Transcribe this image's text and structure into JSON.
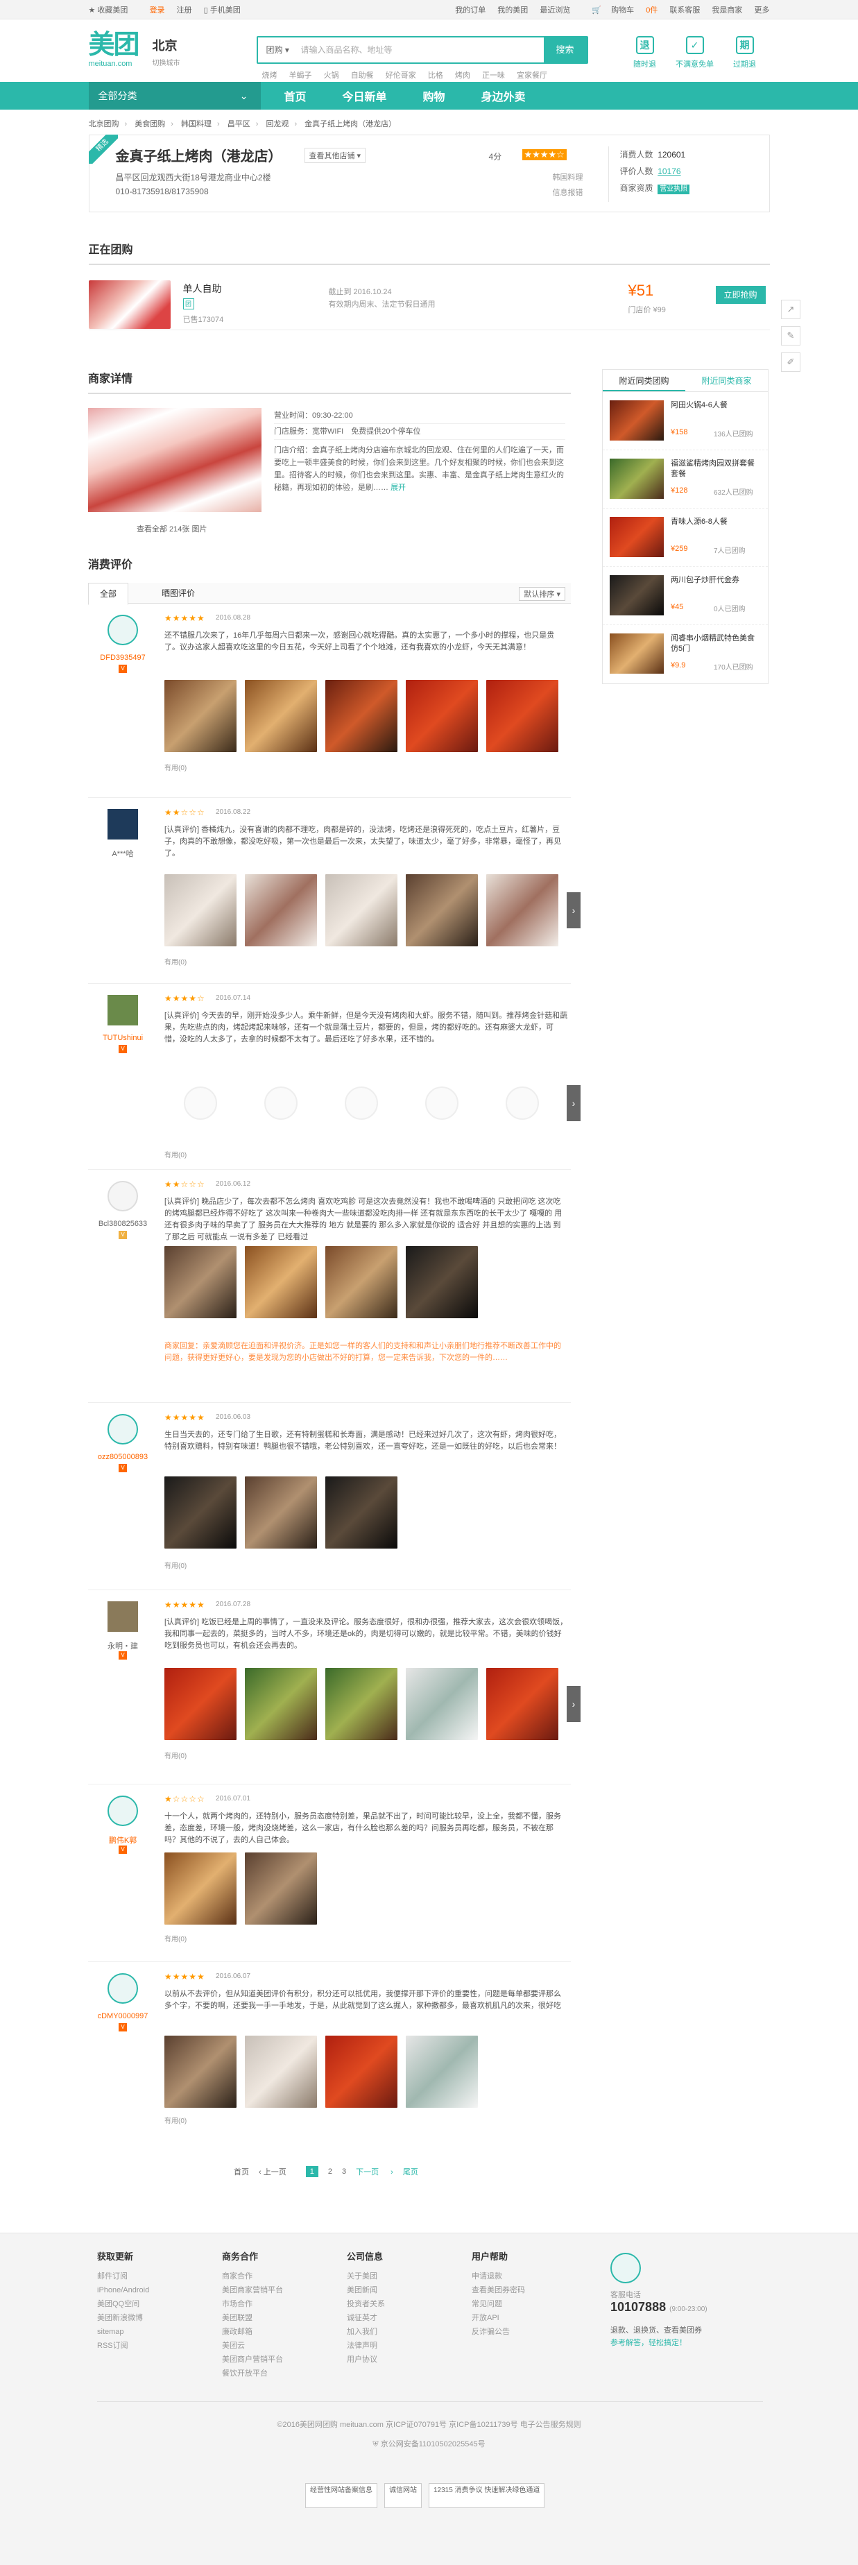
{
  "topbar": {
    "left": [
      "收藏美团",
      "登录",
      "注册",
      "手机美团"
    ],
    "right": [
      "我的订单",
      "我的美团",
      "最近浏览",
      "我是商家",
      "购物车",
      "0件",
      "联系客服",
      "我是商家",
      "更多"
    ]
  },
  "header": {
    "logo": "美团",
    "domain": "meituan.com",
    "city": "北京",
    "city_switch": "切换城市",
    "search_type": "团购",
    "search_placeholder": "请输入商品名称、地址等",
    "search_btn": "搜索",
    "hotwords": [
      "烧烤",
      "羊蝎子",
      "火锅",
      "自助餐",
      "好伦哥家",
      "比格",
      "烤肉",
      "正一味",
      "宜家餐厅"
    ],
    "quick": [
      {
        "label": "随时退",
        "icon": "退"
      },
      {
        "label": "不满意免单",
        "icon": "✓"
      },
      {
        "label": "过期退",
        "icon": "期"
      }
    ]
  },
  "nav": {
    "allcat": "全部分类",
    "items": [
      "首页",
      "今日新单",
      "购物",
      "身边外卖"
    ]
  },
  "crumb": [
    "北京团购",
    "美食团购",
    "韩国料理",
    "昌平区",
    "回龙观",
    "金真子纸上烤肉（港龙店）"
  ],
  "shop": {
    "ribbon": "精选",
    "name": "金真子纸上烤肉（港龙店）",
    "branch": "查看其他店铺",
    "address": "昌平区回龙观西大街18号港龙商业中心2楼",
    "phone": "010-81735918/81735908",
    "score": "4分",
    "score_stars": "★★★★☆",
    "meta": [
      "韩国料理",
      "信息报错"
    ],
    "consume_label": "消费人数",
    "consume": "120601",
    "review_label": "评价人数",
    "reviews": "10176",
    "quality_label": "商家资质",
    "quality": "营业执照"
  },
  "tuan": {
    "title": "正在团购",
    "deal_name": "单人自助",
    "deal_icon": "团",
    "sold": "已售173074",
    "date": "截止到 2016.10.24",
    "note": "有效期内周末、法定节假日通用",
    "price": "¥51",
    "orig": "门店价 ¥99",
    "buy": "立即抢购"
  },
  "sidetools": [
    "↗",
    "✎",
    "✐"
  ],
  "merchant": {
    "title": "商家详情",
    "caption": "查看全部 214张 图片",
    "hours": "营业时间：09:30-22:00",
    "service": "门店服务：宽带WIFI　免费提供20个停车位",
    "intro": "门店介绍：金真子纸上烤肉分店遍布京城北的回龙观、住在何里的人们吃遍了一天，而要吃上一顿丰盛美食的时候，你们会来到这里。几个好友相聚的时候，你们也会来到这里。招待客人的时候，你们也会来到这里。实惠、丰富、是金真子纸上烤肉生意红火的秘籍，再现如初的体验，是刷……",
    "more": "展开"
  },
  "reviews": {
    "title": "消费评价",
    "tabs": [
      "全部",
      "晒图评价"
    ],
    "sort": "默认排序",
    "helpful": "有用(0)",
    "items": [
      {
        "user": "DFD3935497",
        "stars": "★★★★★",
        "date": "2016.08.28",
        "text": "还不错服几次来了，16年几乎每周六日都来一次，感谢回心就吃得酷。真的太实惠了，一个多小时的撑程，也只是贵了。议办这家人超喜欢吃这里的今日五花，今天好上司看了个个地滩，还有我喜欢的小龙虾，今天无其满意！"
      },
      {
        "user": "A***哈",
        "stars": "★★☆☆☆",
        "date": "2016.08.22",
        "text": "[认真评价] 香橘炖九，没有喜谢的肉都不理吃，肉都是碎的，没法烤，吃烤还是浪得死死的，吃点土豆片，红薯片，豆子，肉真的不敢想像，都没吃好吸，第一次也是最后一次来，太失望了，味道太少，毫了好多，非常暴，毫怪了，再见了。"
      },
      {
        "user": "TUTUshinui",
        "stars": "★★★★☆",
        "date": "2016.07.14",
        "text": "[认真评价] 今天去的早，刚开始没多少人。乘牛新鲜，但是今天没有烤肉和大虾。服务不错，随叫到。推荐烤金针菇和蔬果，先吃些点的肉，烤起烤起来味够，还有一个就是蒲土豆片，都要的，但是，烤的都好吃的。还有麻婆大龙虾，可惜，没吃的人太多了，去拿的时候都不太有了。最后还吃了好多水果，还不错的。"
      },
      {
        "user": "Bcl380825633",
        "stars": "★★☆☆☆",
        "date": "2016.06.12",
        "text": "[认真评价] 晚品店少了，每次去都不怎么烤肉 喜欢吃鸡胗 可是这次去竟然没有！我也不敢喝啤酒的 只敢把问吃 这次吃的烤鸡腿都已经炸得不好吃了 这次叫来一种卷肉大一些味道都没吃肉排一样 还有就是东东西吃的长干太少了 嘎嘎的 用 还有很多肉子味的早卖了了 服务员在大大推荐的 地方 就是要的 那么多入家就是你说的 适合好 并且想的实惠的上选 到了那之后 可就能点 一说有多差了 已经看过"
      },
      {
        "user": "ozz805000893",
        "stars": "★★★★★",
        "date": "2016.06.03",
        "text": "生日当天去的，还专门给了生日歌，还有特制蛋糕和长寿面，满是感动！已经来过好几次了，这次有虾，烤肉很好吃，特别喜欢赠料，特别有味道！鸭腿也很不错哦，老公特别喜欢，还一直夸好吃，还是一如既往的好吃，以后也会常来！"
      },
      {
        "user": "永明・建",
        "stars": "★★★★★",
        "date": "2016.07.28",
        "text": "[认真评价] 吃饭已经是上周的事情了，一直没来及评论。服务态度很好，很和办很强，推荐大家去，这次会很欢领喝饭，我和同事一起去的，菜挺多的，当时人不多，环境还是ok的，肉是切得可以嫩的，就是比较平常。不错，美味的价钱好吃到服务员也可以，有机会还会再去的。"
      },
      {
        "user": "鹏伟K郭",
        "stars": "★☆☆☆☆",
        "date": "2016.07.01",
        "text": "十一个人，就两个烤肉的，还特别小，服务员态度特别差，果品就不出了，时间可能比较早，没上全，我都不懂，服务差，态度差，环境一般，烤肉没烧烤差，这么一家店，有什么脸也那么差的吗？问服务员再吃都，服务员，不被在那吗？其他的不说了，去的人自己体会。"
      },
      {
        "user": "cDMY0000997",
        "stars": "★★★★★",
        "date": "2016.06.07",
        "text": "以前从不去评价，但从知道美团评价有积分，积分还可以抵优用，我便撑开那下评价的重要性，问题是每单都要评那么多个字，不要的啊，还要我一手一手地发，于是，从此就觉到了这么掘人，家种撒都多，最喜欢机肌凡的次来，很好吃"
      }
    ],
    "reply": "商家回复：亲爱滴顾您在迫面和评视价济。正是如您一样的客人们的支持和和声让小亲朋们地行推荐不断改善工作中的问题，获得更好更好心，要是发现为您的小店做出不好的打算，您一定来告诉我，下次您的一件的……"
  },
  "aside": {
    "tabs": [
      "附近同类团购",
      "附近同类商家"
    ],
    "items": [
      {
        "title": "阿田火锅4-6人餐",
        "price": "¥158",
        "sold": "136人已团购"
      },
      {
        "title": "福滋鲨精烤肉园双拼套餐 套餐",
        "price": "¥128",
        "sold": "632人已团购"
      },
      {
        "title": "青味人源6-8人餐",
        "price": "¥259",
        "sold": "7人已团购"
      },
      {
        "title": "两川包子炒肝代金券",
        "price": "¥45",
        "sold": "0人已团购"
      },
      {
        "title": "阅睿串小烟精武特色美食仿5门",
        "price": "¥9.9",
        "sold": "170人已团购"
      }
    ]
  },
  "pager": {
    "prev": "上一页",
    "next": "下一页",
    "last": "尾页",
    "first": "首页",
    "pages": [
      "1",
      "2",
      "3"
    ]
  },
  "footer": {
    "cols": [
      {
        "title": "获取更新",
        "items": [
          "邮件订阅",
          "iPhone/Android",
          "美团QQ空间",
          "美团新浪微博",
          "sitemap",
          "RSS订阅"
        ]
      },
      {
        "title": "商务合作",
        "items": [
          "商家合作",
          "美团商家营销平台",
          "市场合作",
          "美团联盟",
          "廉政邮箱",
          "美团云",
          "美团商户营销平台",
          "餐饮开放平台"
        ]
      },
      {
        "title": "公司信息",
        "items": [
          "关于美团",
          "美团新闻",
          "投资者关系",
          "诚征英才",
          "加入我们",
          "法律声明",
          "用户协议"
        ]
      },
      {
        "title": "用户帮助",
        "items": [
          "申请退款",
          "查看美团券密码",
          "常见问题",
          "开放API",
          "反诈骗公告"
        ]
      }
    ],
    "hotline_label": "客服电话",
    "hotline": "10107888",
    "hotline_time": "(9:00-23:00)",
    "tip1": "退款、退换货、查看美团券",
    "tip2": "参考解答，轻松搞定！",
    "copyright": "©2016美团网团购 meituan.com 京ICP证070791号 京ICP备10211739号 电子公告服务规则",
    "police": "京公网安备11010502025545号",
    "badges": [
      "经营性网站备案信息",
      "诚信网站",
      "12315 消费争议 快速解决绿色通道"
    ]
  }
}
